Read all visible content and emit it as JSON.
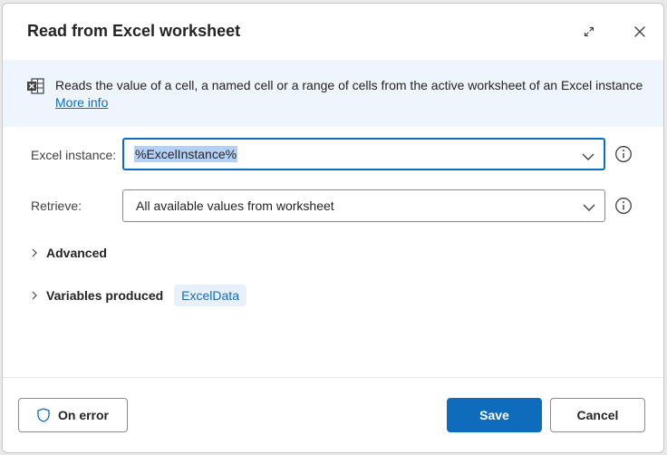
{
  "dialog": {
    "title": "Read from Excel worksheet"
  },
  "info": {
    "description": "Reads the value of a cell, a named cell or a range of cells from the active worksheet of an Excel instance",
    "more_info_label": "More info"
  },
  "fields": {
    "excel_instance": {
      "label": "Excel instance:",
      "value": "%ExcelInstance%"
    },
    "retrieve": {
      "label": "Retrieve:",
      "value": "All available values from worksheet"
    }
  },
  "sections": {
    "advanced_label": "Advanced",
    "variables_label": "Variables produced",
    "variables": [
      "ExcelData"
    ]
  },
  "footer": {
    "on_error_label": "On error",
    "save_label": "Save",
    "cancel_label": "Cancel"
  },
  "colors": {
    "accent": "#0f6cbd",
    "banner_bg": "#eff5fc"
  }
}
